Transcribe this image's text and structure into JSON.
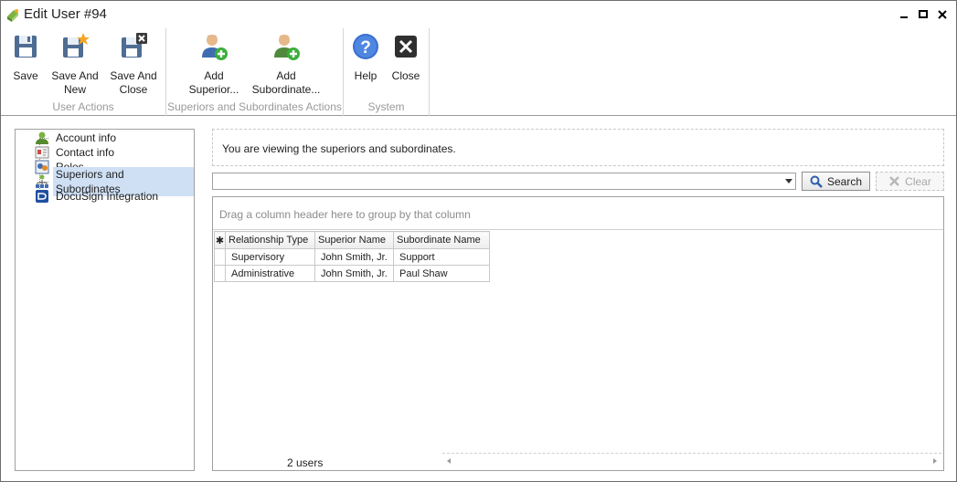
{
  "window": {
    "title": "Edit User #94",
    "controls": [
      "minimize-icon",
      "maximize-icon",
      "close-icon"
    ]
  },
  "ribbon": {
    "groups": [
      {
        "label": "User Actions",
        "buttons": [
          {
            "label": "Save",
            "icon": "save-icon"
          },
          {
            "label": "Save And\nNew",
            "icon": "save-and-new-icon"
          },
          {
            "label": "Save And\nClose",
            "icon": "save-and-close-icon"
          }
        ]
      },
      {
        "label": "Superiors and Subordinates Actions",
        "buttons": [
          {
            "label": "Add\nSuperior...",
            "icon": "add-superior-icon"
          },
          {
            "label": "Add\nSubordinate...",
            "icon": "add-subordinate-icon"
          }
        ]
      },
      {
        "label": "System",
        "buttons": [
          {
            "label": "Help",
            "icon": "help-icon"
          },
          {
            "label": "Close",
            "icon": "close-icon"
          }
        ]
      }
    ]
  },
  "tree": {
    "items": [
      {
        "label": "Account info",
        "icon": "user-icon"
      },
      {
        "label": "Contact info",
        "icon": "contact-card-icon"
      },
      {
        "label": "Roles",
        "icon": "roles-icon"
      },
      {
        "label": "Superiors and Subordinates",
        "icon": "hierarchy-icon",
        "selected": true
      },
      {
        "label": "DocuSign Integration",
        "icon": "docusign-icon"
      }
    ]
  },
  "info": {
    "text": "You are viewing the superiors and subordinates."
  },
  "search": {
    "value": "",
    "search_label": "Search",
    "clear_label": "Clear"
  },
  "grid": {
    "group_hint": "Drag a column header here to group by that column",
    "new_row_marker": "✱",
    "columns": [
      "Relationship Type",
      "Superior Name",
      "Subordinate Name"
    ],
    "rows": [
      [
        "Supervisory",
        "John Smith, Jr.",
        "Support"
      ],
      [
        "Administrative",
        "John Smith, Jr.",
        "Paul Shaw"
      ]
    ],
    "footer_count": "2 users"
  },
  "colors": {
    "selection": "#cfe0f5",
    "group_label": "#9a9a9a",
    "help_blue": "#3a6fd0"
  }
}
